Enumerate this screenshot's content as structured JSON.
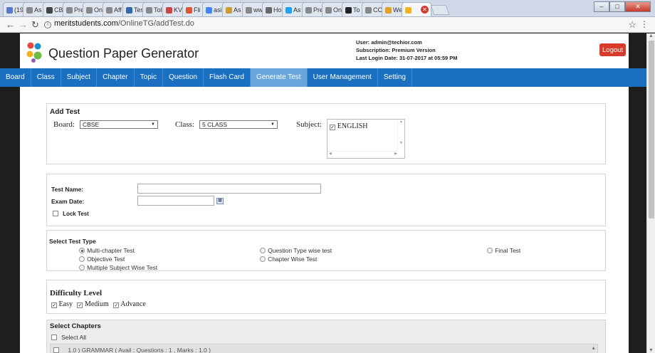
{
  "browser": {
    "tabs": [
      {
        "label": "(19",
        "color": "#5577cc"
      },
      {
        "label": "As",
        "color": "#888888"
      },
      {
        "label": "CB as",
        "color": "#444444"
      },
      {
        "label": "Pre",
        "color": "#888888"
      },
      {
        "label": "On",
        "color": "#888888"
      },
      {
        "label": "Aff",
        "color": "#888888"
      },
      {
        "label": "Tes",
        "color": "#3366aa"
      },
      {
        "label": "Tol",
        "color": "#888888"
      },
      {
        "label": "KV",
        "color": "#cc4444"
      },
      {
        "label": "Fli",
        "color": "#dd5533"
      },
      {
        "label": "asi",
        "color": "#4285f4"
      },
      {
        "label": "As",
        "color": "#cc9933"
      },
      {
        "label": "ww",
        "color": "#888888"
      },
      {
        "label": "Ho",
        "color": "#666666"
      },
      {
        "label": "As",
        "color": "#1da1f2"
      },
      {
        "label": "Pre",
        "color": "#888888"
      },
      {
        "label": "On",
        "color": "#888888"
      },
      {
        "label": "To",
        "color": "#222222"
      },
      {
        "label": "CC",
        "color": "#888888"
      },
      {
        "label": "We",
        "color": "#e0a020"
      }
    ],
    "url_host": "meritstudents.com",
    "url_path": "/OnlineTG/addTest.do"
  },
  "header": {
    "title": "Question Paper Generator",
    "user_line": "User:   admin@techior.com",
    "subscription_line": "Subscription: Premium Version",
    "last_login_line": "Last Login Date: 31-07-2017 at 05:59 PM",
    "logout_label": "Logout"
  },
  "nav": {
    "items": [
      "Board",
      "Class",
      "Subject",
      "Chapter",
      "Topic",
      "Question",
      "Flash Card",
      "Generate Test",
      "User Management",
      "Setting"
    ],
    "active": "Generate Test"
  },
  "add_test": {
    "title": "Add Test",
    "board_label": "Board:",
    "board_value": "CBSE",
    "class_label": "Class:",
    "class_value": "5 CLASS",
    "subject_label": "Subject:",
    "subject_item": "ENGLISH"
  },
  "details": {
    "test_name_label": "Test Name:",
    "test_name_value": "",
    "exam_date_label": "Exam Date:",
    "exam_date_value": "",
    "lock_test_label": "Lock Test"
  },
  "test_type": {
    "title": "Select Test Type",
    "options": {
      "multi_chapter": "Multi-chapter Test",
      "objective": "Objective Test",
      "multiple_subject": "Multiple Subject Wise Test",
      "question_type": "Question Type wise test",
      "chapter_wise": "Chapter Wise Test",
      "final": "Final Test"
    },
    "selected": "Multi-chapter Test"
  },
  "difficulty": {
    "title": "Difficulty Level",
    "easy": "Easy",
    "medium": "Medium",
    "advance": "Advance"
  },
  "chapters": {
    "title": "Select Chapters",
    "select_all_label": "Select All",
    "first_row": "1.0 ) GRAMMAR ( Avail : Questions : 1 , Marks : 1.0 )"
  },
  "colors": {
    "nav_bar": "#1a6fc0",
    "nav_active": "#6aa5dc",
    "logout": "#d63b2b"
  }
}
